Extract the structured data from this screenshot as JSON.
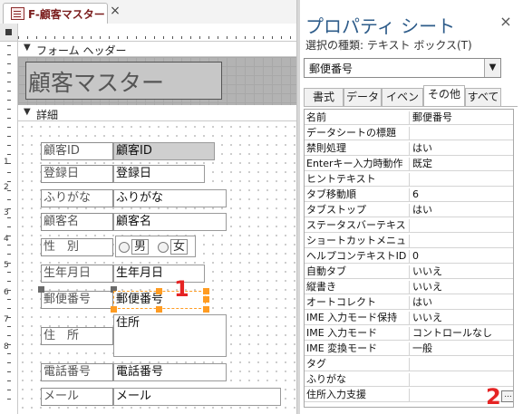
{
  "document_tab": {
    "title": "F-顧客マスター",
    "close_symbol": "×"
  },
  "form": {
    "header_section_label": "フォーム ヘッダー",
    "detail_section_label": "詳細",
    "section_arrow": "▼",
    "title_label": "顧客マスター",
    "ruler_numbers": [
      "1",
      "2",
      "3",
      "4",
      "5",
      "6",
      "7",
      "8"
    ],
    "fields": [
      {
        "label": "顧客ID",
        "control": "顧客ID"
      },
      {
        "label": "登録日",
        "control": "登録日"
      },
      {
        "label": "ふりがな",
        "control": "ふりがな"
      },
      {
        "label": "顧客名",
        "control": "顧客名"
      },
      {
        "label": "性　別",
        "control": ""
      },
      {
        "label": "生年月日",
        "control": "生年月日"
      },
      {
        "label": "郵便番号",
        "control": "郵便番号"
      },
      {
        "label": "住　所",
        "control": "住所"
      },
      {
        "label": "電話番号",
        "control": "電話番号"
      },
      {
        "label": "メール",
        "control": "メール"
      }
    ],
    "gender_options": [
      "男",
      "女"
    ]
  },
  "callouts": {
    "one": "1",
    "two": "2"
  },
  "property_sheet": {
    "title": "プロパティ シート",
    "close_symbol": "×",
    "selection_type": "選択の種類:  テキスト ボックス(T)",
    "selected_object": "郵便番号",
    "dropdown_symbol": "▼",
    "tabs": [
      "書式",
      "データ",
      "イベント",
      "その他",
      "すべて"
    ],
    "active_tab": "その他",
    "build_button": "...",
    "properties": [
      {
        "name": "名前",
        "value": "郵便番号"
      },
      {
        "name": "データシートの標題",
        "value": ""
      },
      {
        "name": "禁則処理",
        "value": "はい"
      },
      {
        "name": "Enterキー入力時動作",
        "value": "既定"
      },
      {
        "name": "ヒントテキスト",
        "value": ""
      },
      {
        "name": "タブ移動順",
        "value": "6"
      },
      {
        "name": "タブストップ",
        "value": "はい"
      },
      {
        "name": "ステータスバーテキスト",
        "value": ""
      },
      {
        "name": "ショートカットメニューバー",
        "value": ""
      },
      {
        "name": "ヘルプコンテキストID",
        "value": "0"
      },
      {
        "name": "自動タブ",
        "value": "いいえ"
      },
      {
        "name": "縦書き",
        "value": "いいえ"
      },
      {
        "name": "オートコレクト",
        "value": "はい"
      },
      {
        "name": "IME 入力モード保持",
        "value": "いいえ"
      },
      {
        "name": "IME 入力モード",
        "value": "コントロールなし"
      },
      {
        "name": "IME 変換モード",
        "value": "一般"
      },
      {
        "name": "タグ",
        "value": ""
      },
      {
        "name": "ふりがな",
        "value": ""
      },
      {
        "name": "住所入力支援",
        "value": ""
      }
    ]
  }
}
